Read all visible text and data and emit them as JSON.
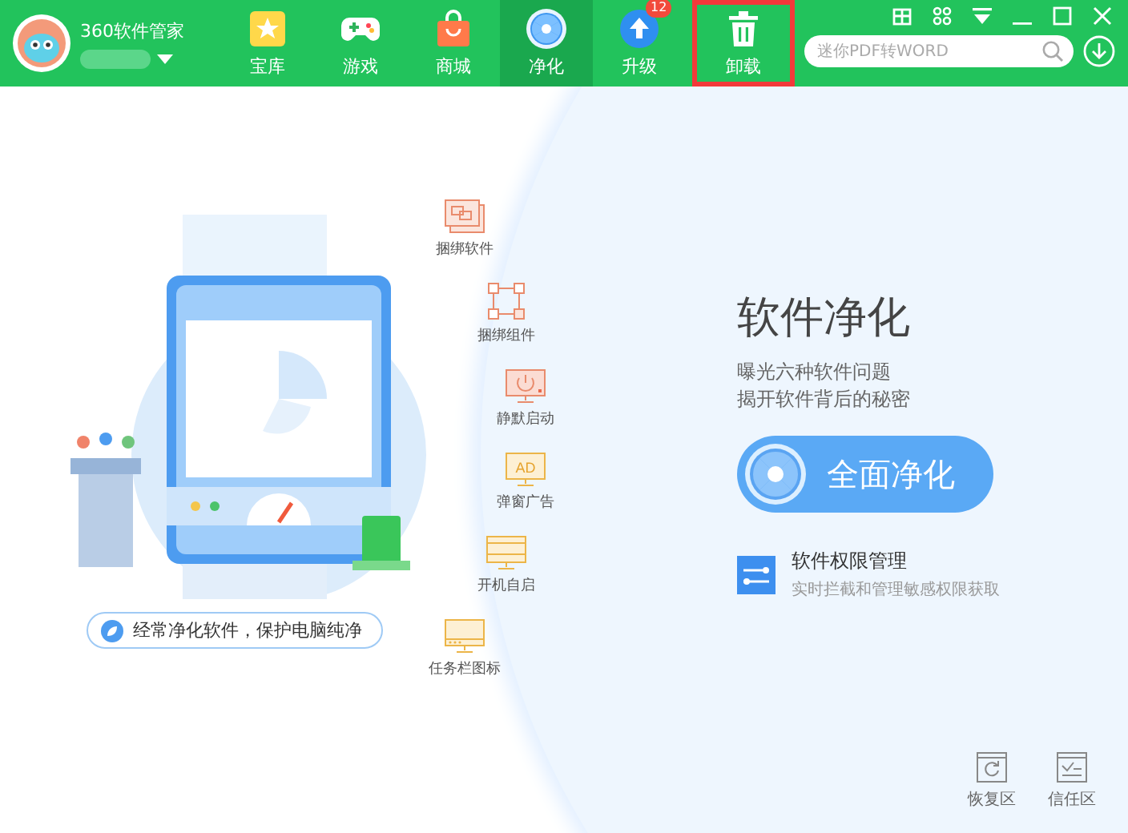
{
  "app": {
    "title": "360软件管家"
  },
  "tabs": [
    {
      "label": "宝库",
      "kind": "star",
      "selected": false,
      "highlighted": false
    },
    {
      "label": "游戏",
      "kind": "gamepad",
      "selected": false,
      "highlighted": false
    },
    {
      "label": "商城",
      "kind": "bag",
      "selected": false,
      "highlighted": false
    },
    {
      "label": "净化",
      "kind": "fan",
      "selected": true,
      "highlighted": false
    },
    {
      "label": "升级",
      "kind": "upload",
      "selected": false,
      "highlighted": false,
      "badge": "12"
    },
    {
      "label": "卸载",
      "kind": "trash",
      "selected": false,
      "highlighted": true
    }
  ],
  "search": {
    "placeholder": "迷你PDF转WORD"
  },
  "features": [
    {
      "label": "捆绑软件",
      "kind": "windows"
    },
    {
      "label": "捆绑组件",
      "kind": "nodes"
    },
    {
      "label": "静默启动",
      "kind": "power"
    },
    {
      "label": "弹窗广告",
      "kind": "ad",
      "icon_text": "AD"
    },
    {
      "label": "开机自启",
      "kind": "screen"
    },
    {
      "label": "任务栏图标",
      "kind": "taskbar"
    }
  ],
  "slogan": "经常净化软件，保护电脑纯净",
  "panel": {
    "title": "软件净化",
    "lines": [
      "曝光六种软件问题",
      "揭开软件背后的秘密"
    ],
    "button": "全面净化",
    "permission": {
      "title": "软件权限管理",
      "subtitle": "实时拦截和管理敏感权限获取"
    }
  },
  "bottom": [
    {
      "label": "恢复区",
      "kind": "restore"
    },
    {
      "label": "信任区",
      "kind": "trust"
    }
  ]
}
